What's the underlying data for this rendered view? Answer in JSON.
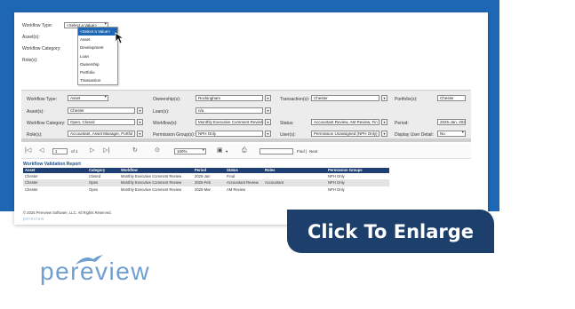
{
  "top_form": {
    "workflow_type_label": "Workflow Type:",
    "workflow_type_value": "<Select a Value>",
    "asset_label": "Asset(s):",
    "workflow_category_label": "Workflow Category:",
    "role_label": "Role(s):",
    "dropdown_options": [
      "<Select a Value>",
      "Asset",
      "Development",
      "Loan",
      "Ownership",
      "Portfolio",
      "Transaction"
    ]
  },
  "params": {
    "workflow_type_label": "Workflow Type:",
    "workflow_type_value": "Asset",
    "ownership_label": "Ownership(s):",
    "ownership_value": "Rockingham",
    "transaction_label": "Transaction(s):",
    "transaction_value": "Chester",
    "portfolio_label": "Portfolio(s):",
    "portfolio_value": "Chester",
    "asset_label": "Asset(s):",
    "asset_value": "Chester",
    "loan_label": "Loan(s):",
    "loan_value": "n/a",
    "workflow_category_label": "Workflow Category:",
    "workflow_category_value": "Open, Closed",
    "workflow_label": "Workflow(s):",
    "workflow_value": "Monthly Executive Comment Review",
    "status_label": "Status:",
    "status_value": "Accountant Review, AM Review, Fin",
    "period_label": "Period:",
    "period_value": "2025-Jan, 2025-Feb, 2025-Mar",
    "role_label": "Role(s):",
    "role_value": "Accountant, Asset Manager, Portfol",
    "permission_group_label": "Permission Group(s):",
    "permission_group_value": "NPH Only",
    "user_label": "User(s):",
    "user_value": "Permission Unassigned (NPH Only)",
    "display_user_detail_label": "Display User Detail:",
    "display_user_detail_value": "No"
  },
  "toolbar": {
    "first": "|◁",
    "prev": "◁",
    "page": "1",
    "of_label": "of 1",
    "next": "▷",
    "last": "▷|",
    "zoom": "100%",
    "find_label": "Find",
    "separator": "|",
    "next_label": "Next"
  },
  "report": {
    "title": "Workflow Validation Report",
    "columns": [
      "Asset",
      "Category",
      "Workflow",
      "Period",
      "Status",
      "Roles",
      "Permission Groups"
    ],
    "rows": [
      [
        "Chester",
        "Closed",
        "Monthly Executive Comment Review",
        "2025-Jan",
        "Final",
        "",
        "NPH Only"
      ],
      [
        "Chester",
        "Open",
        "Monthly Executive Comment Review",
        "2025-Feb",
        "Accountant Review",
        "Accountant",
        "NPH Only"
      ],
      [
        "Chester",
        "Open",
        "Monthly Executive Comment Review",
        "2025-Mar",
        "AM Review",
        "",
        "NPH Only"
      ]
    ],
    "copyright": "© 2025 Pereview Software, LLC. All Rights Reserved.",
    "mini_logo": "pereview"
  },
  "cta": {
    "label": "Click To Enlarge",
    "color": "#1d3f6b"
  },
  "brand": {
    "name": "pereview",
    "color": "#6f9fd1"
  },
  "colors": {
    "blue_background": "#1e67b5",
    "table_header": "#1e3f73"
  }
}
